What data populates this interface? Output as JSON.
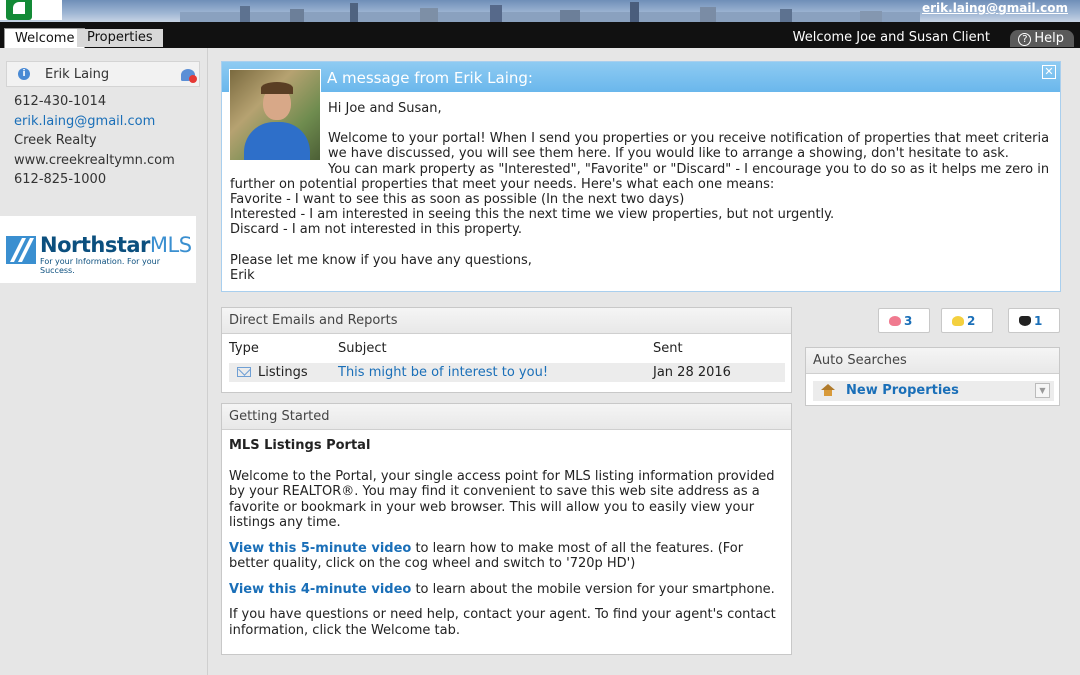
{
  "header": {
    "user_email": "erik.laing@gmail.com",
    "tabs": [
      {
        "label": "Welcome",
        "active": true
      },
      {
        "label": "Properties",
        "active": false
      }
    ],
    "welcome_text": "Welcome Joe and Susan Client",
    "help_label": "Help"
  },
  "sidebar": {
    "agent_name": "Erik Laing",
    "phone": "612-430-1014",
    "email": "erik.laing@gmail.com",
    "company": "Creek Realty",
    "website": "www.creekrealtymn.com",
    "office_phone": "612-825-1000",
    "logo": {
      "brand_bold": "Northstar",
      "brand_light": "MLS",
      "tagline": "For your Information. For your Success."
    }
  },
  "message": {
    "title": "A message from Erik Laing:",
    "close_glyph": "✕",
    "greeting": "Hi Joe and Susan,",
    "para1": "Welcome to your portal! When I send you properties or you receive notification of properties that meet criteria we have discussed, you will see them here. If you would like to arrange a showing, don't hesitate to ask.",
    "para2_line1": "You can mark property as \"Interested\", \"Favorite\" or \"Discard\" - I encourage you to do so as it helps me zero in",
    "para2_line2": "further on potential properties that meet your needs. Here's what each one means:",
    "favorite_line": "Favorite - I want to see this as soon as possible (In the next two days)",
    "interested_line": "Interested - I am interested in seeing this the next time we view properties, but not urgently.",
    "discard_line": "Discard - I am not interested in this property.",
    "closing": "Please let me know if you have any questions,",
    "signature": "Erik"
  },
  "emails": {
    "title": "Direct Emails and Reports",
    "columns": [
      "Type",
      "Subject",
      "Sent"
    ],
    "rows": [
      {
        "type": "Listings",
        "subject": "This might be of interest to you!",
        "sent": "Jan 28 2016"
      }
    ]
  },
  "getting_started": {
    "title": "Getting Started",
    "heading": "MLS Listings Portal",
    "intro": "Welcome to the Portal, your single access point for MLS listing information provided by your REALTOR®. You may find it convenient to save this web site address as a favorite or bookmark in your web browser. This will allow you to easily view your listings any time.",
    "video1_link": "View this 5-minute video",
    "video1_text": " to learn how to make most of all the features. (For better quality, click on the cog wheel and switch to '720p HD')",
    "video2_link": "View this 4-minute video",
    "video2_text": " to learn about the mobile version for your smartphone.",
    "help_text": "If you have questions or need help, contact your agent.  To find your agent's contact information, click the Welcome tab."
  },
  "badges": {
    "favorite_count": "3",
    "interested_count": "2",
    "discard_count": "1"
  },
  "auto_searches": {
    "title": "Auto Searches",
    "items": [
      {
        "label": "New Properties"
      }
    ]
  },
  "colors": {
    "link": "#1a6fb8",
    "message_header": "#6ab7ec",
    "nav": "#111111"
  }
}
